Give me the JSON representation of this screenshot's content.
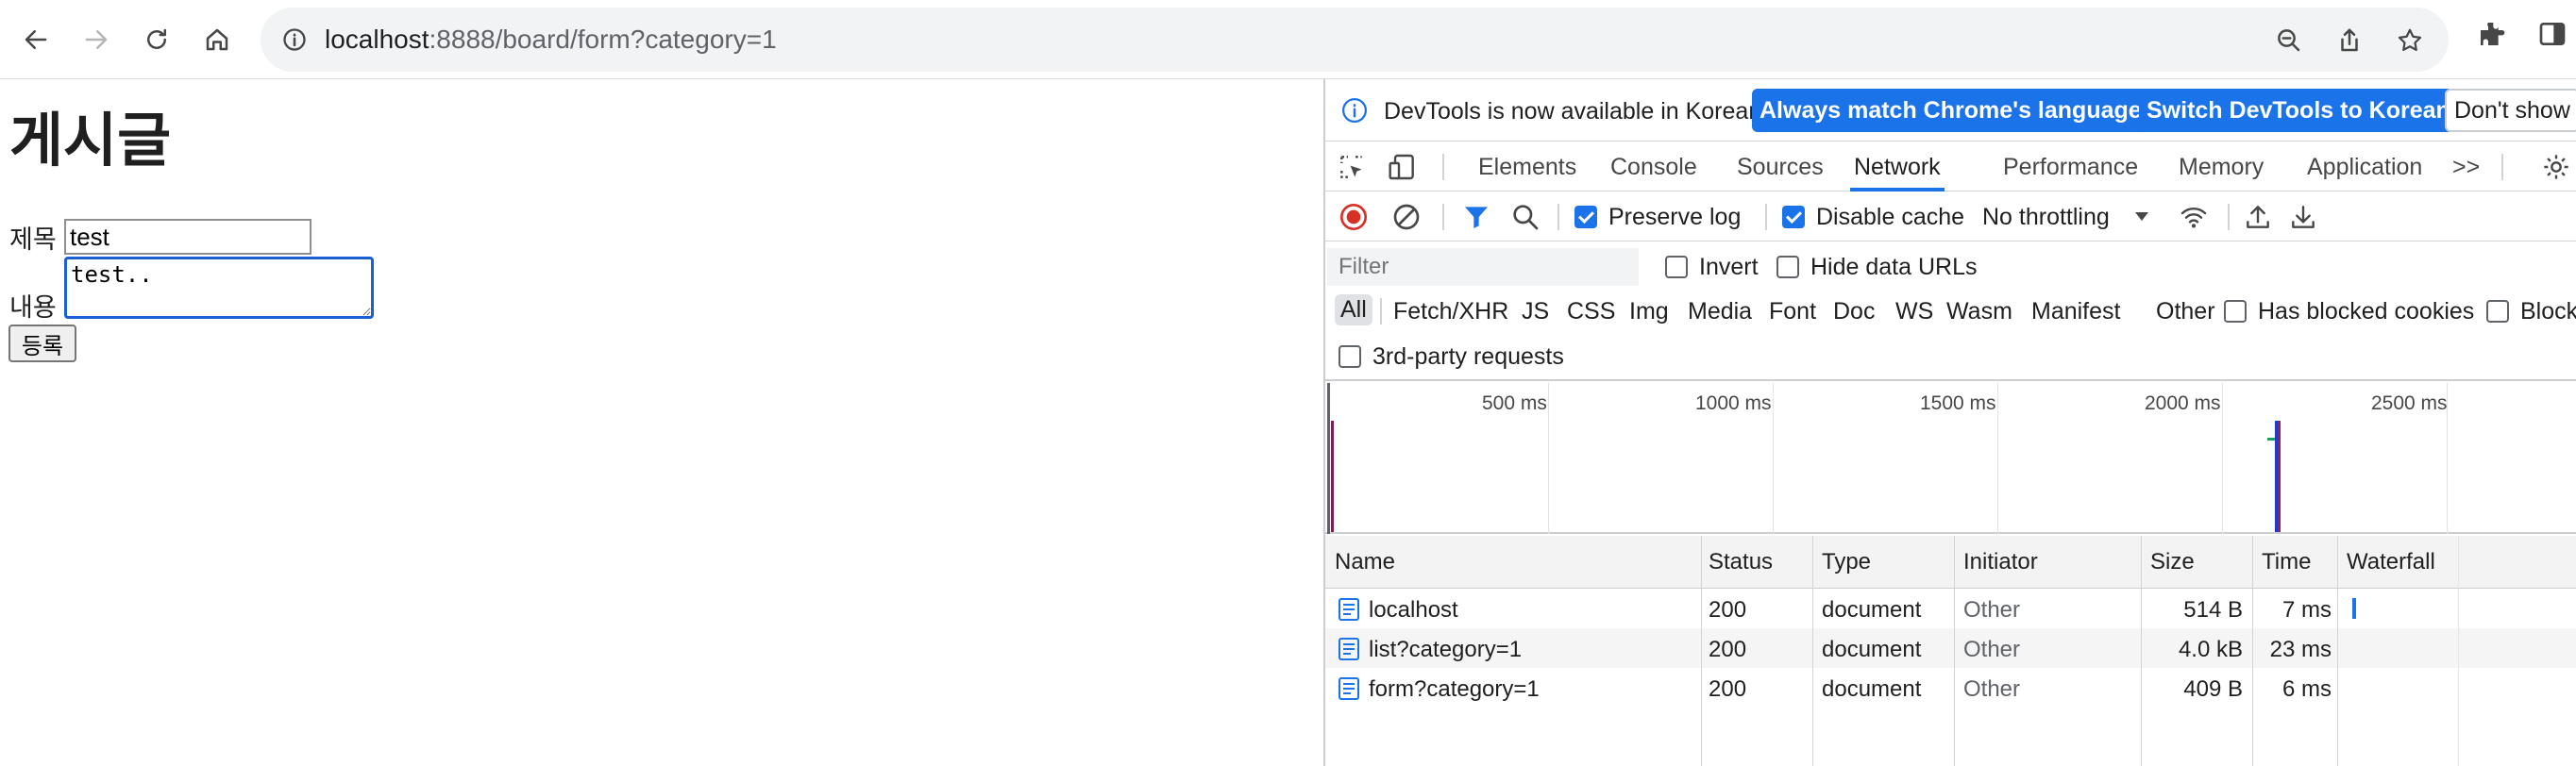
{
  "browser": {
    "url_host": "localhost",
    "url_rest": ":8888/board/form?category=1"
  },
  "page": {
    "heading": "게시글",
    "title_label": "제목",
    "title_value": "test",
    "content_label": "내용",
    "content_value": "test..",
    "submit_label": "등록"
  },
  "devtools": {
    "infobar": {
      "message": "DevTools is now available in Korean!",
      "btn_match": "Always match Chrome's language",
      "btn_switch": "Switch DevTools to Korean",
      "btn_dont": "Don't show"
    },
    "tabs": [
      "Elements",
      "Console",
      "Sources",
      "Network",
      "Performance",
      "Memory",
      "Application"
    ],
    "more_tabs": ">>",
    "controls": {
      "preserve_log": "Preserve log",
      "disable_cache": "Disable cache",
      "throttling": "No throttling"
    },
    "filter": {
      "placeholder": "Filter",
      "invert": "Invert",
      "hide_data_urls": "Hide data URLs"
    },
    "types": [
      "All",
      "Fetch/XHR",
      "JS",
      "CSS",
      "Img",
      "Media",
      "Font",
      "Doc",
      "WS",
      "Wasm",
      "Manifest",
      "Other"
    ],
    "has_blocked_cookies": "Has blocked cookies",
    "blocked_partial": "Block",
    "third_party": "3rd-party requests",
    "timeline_ticks": [
      "500 ms",
      "1000 ms",
      "1500 ms",
      "2000 ms",
      "2500 ms"
    ],
    "columns": [
      "Name",
      "Status",
      "Type",
      "Initiator",
      "Size",
      "Time",
      "Waterfall"
    ],
    "rows": [
      {
        "name": "localhost",
        "status": "200",
        "type": "document",
        "initiator": "Other",
        "size": "514 B",
        "time": "7 ms"
      },
      {
        "name": "list?category=1",
        "status": "200",
        "type": "document",
        "initiator": "Other",
        "size": "4.0 kB",
        "time": "23 ms"
      },
      {
        "name": "form?category=1",
        "status": "200",
        "type": "document",
        "initiator": "Other",
        "size": "409 B",
        "time": "6 ms"
      }
    ],
    "colors": {
      "accent": "#1a73e8",
      "record": "#d93025"
    }
  }
}
